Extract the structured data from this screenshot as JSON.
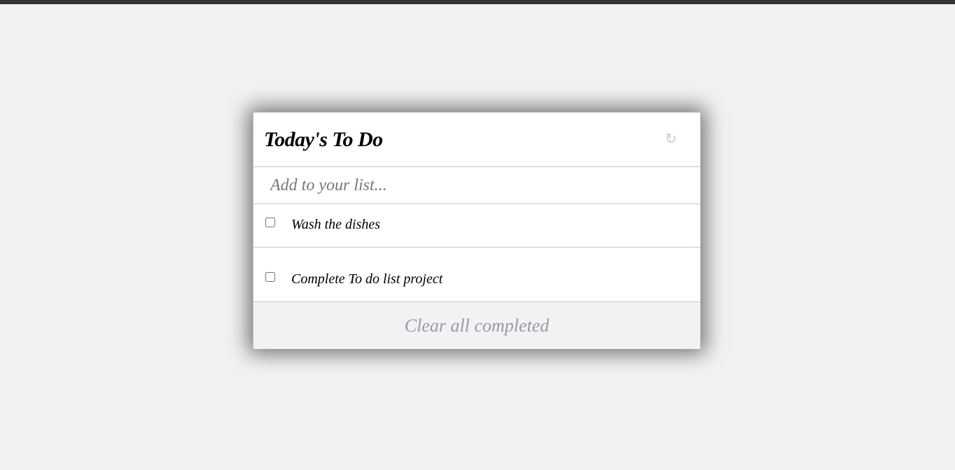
{
  "header": {
    "title": "Today's To Do",
    "refresh_icon": "refresh-icon"
  },
  "input": {
    "placeholder": "Add to your list...",
    "value": ""
  },
  "items": [
    {
      "label": "Wash the dishes",
      "checked": false
    },
    {
      "label": "Complete To do list project",
      "checked": false
    }
  ],
  "footer": {
    "clear_label": "Clear all completed"
  }
}
